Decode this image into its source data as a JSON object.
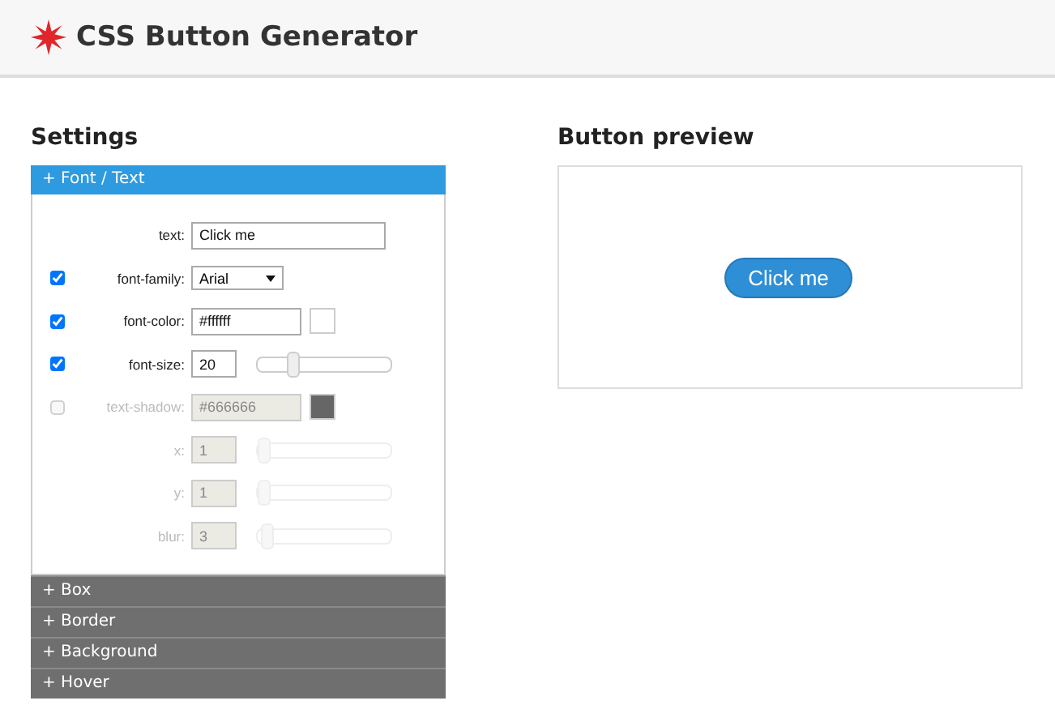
{
  "header": {
    "title": "CSS Button Generator"
  },
  "settings": {
    "title": "Settings",
    "sections": [
      {
        "label": "+ Font / Text",
        "expanded": true,
        "rows": [
          {
            "kind": "text",
            "label": "text:",
            "value": "Click me",
            "disabled": false
          },
          {
            "kind": "select",
            "label": "font-family:",
            "value": "Arial",
            "checked": true,
            "disabled": false
          },
          {
            "kind": "color",
            "label": "font-color:",
            "value": "#ffffff",
            "checked": true,
            "disabled": false,
            "color": "#ffffff"
          },
          {
            "kind": "slider",
            "label": "font-size:",
            "value": "20",
            "checked": true,
            "disabled": false,
            "level": 0.25
          },
          {
            "kind": "color",
            "label": "text-shadow:",
            "value": "#666666",
            "checked": false,
            "disabled": true,
            "color": "#666666"
          },
          {
            "kind": "slider",
            "label": "x:",
            "value": "1",
            "disabled": true,
            "level": 0
          },
          {
            "kind": "slider",
            "label": "y:",
            "value": "1",
            "disabled": true,
            "level": 0
          },
          {
            "kind": "slider",
            "label": "blur:",
            "value": "3",
            "disabled": true,
            "level": 0.03
          }
        ]
      },
      {
        "label": "+ Box",
        "expanded": false
      },
      {
        "label": "+ Border",
        "expanded": false
      },
      {
        "label": "+ Background",
        "expanded": false
      },
      {
        "label": "+ Hover",
        "expanded": false
      }
    ]
  },
  "preview": {
    "title": "Button preview",
    "button": "Click me"
  }
}
